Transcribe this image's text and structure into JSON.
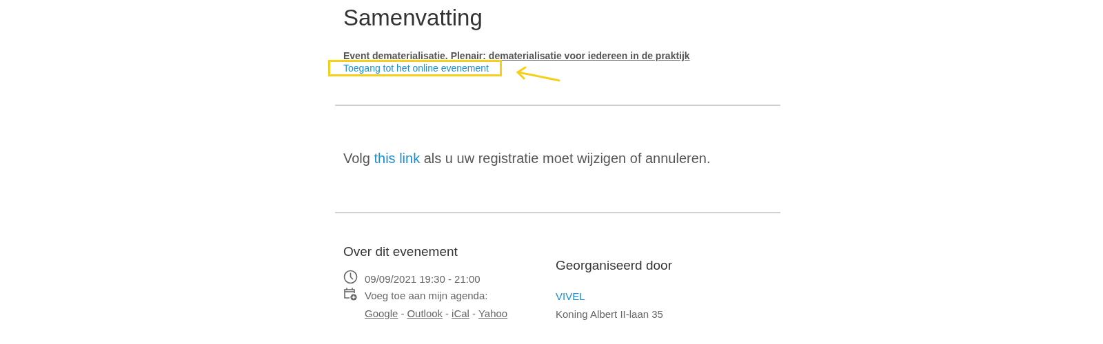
{
  "title": "Samenvatting",
  "event": {
    "name": "Event dematerialisatie. Plenair: dematerialisatie voor iedereen in de praktijk",
    "access_link": {
      "label": "Toegang tot het online evenement",
      "highlighted": true
    }
  },
  "change_notice": {
    "before": "Volg",
    "link": "this link",
    "after": "als u uw registratie moet wijzigen of annuleren."
  },
  "about": {
    "heading": "Over dit evenement",
    "datetime": "09/09/2021 19:30 - 21:00",
    "calendar_label": "Voeg toe aan mijn agenda:",
    "separator": "-",
    "calendar_links": [
      "Google",
      "Outlook",
      "iCal",
      "Yahoo"
    ]
  },
  "organizer": {
    "heading": "Georganiseerd door",
    "name": "VIVEL",
    "address": "Koning Albert II-laan 35"
  }
}
